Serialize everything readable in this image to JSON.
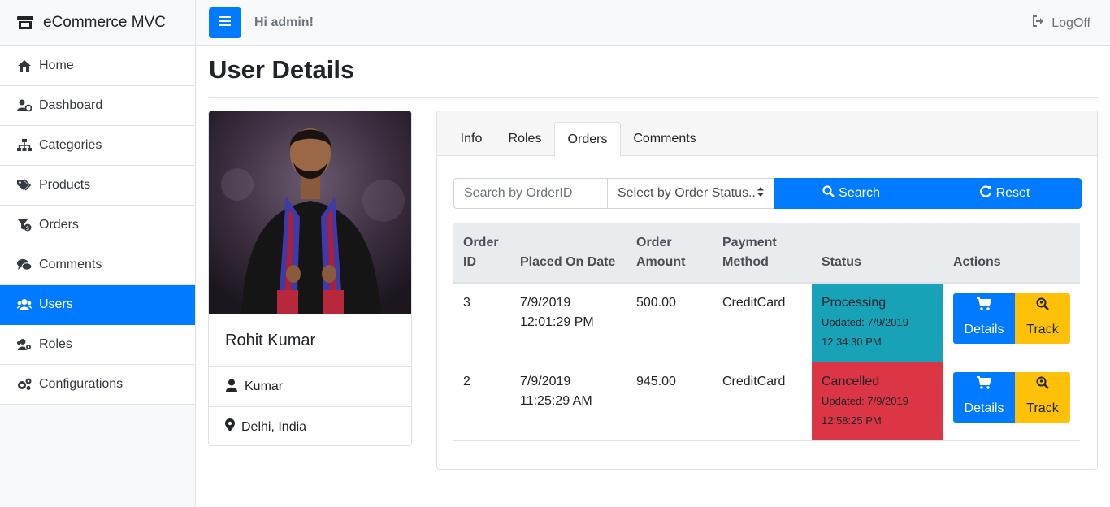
{
  "brand": {
    "title": "eCommerce MVC"
  },
  "sidebar": {
    "items": [
      {
        "label": "Home",
        "icon": "home-icon",
        "active": false
      },
      {
        "label": "Dashboard",
        "icon": "user-chart-icon",
        "active": false
      },
      {
        "label": "Categories",
        "icon": "sitemap-icon",
        "active": false
      },
      {
        "label": "Products",
        "icon": "tags-icon",
        "active": false
      },
      {
        "label": "Orders",
        "icon": "funnel-dollar-icon",
        "active": false
      },
      {
        "label": "Comments",
        "icon": "comments-icon",
        "active": false
      },
      {
        "label": "Users",
        "icon": "users-icon",
        "active": true
      },
      {
        "label": "Roles",
        "icon": "users-cog-icon",
        "active": false
      },
      {
        "label": "Configurations",
        "icon": "cogs-icon",
        "active": false
      }
    ]
  },
  "header": {
    "greeting": "Hi admin!",
    "logoff_label": "LogOff"
  },
  "page": {
    "title": "User Details"
  },
  "profile": {
    "name": "Rohit Kumar",
    "username": "Kumar",
    "location": "Delhi, India"
  },
  "tabs": [
    {
      "label": "Info",
      "active": false
    },
    {
      "label": "Roles",
      "active": false
    },
    {
      "label": "Orders",
      "active": true
    },
    {
      "label": "Comments",
      "active": false
    }
  ],
  "search": {
    "placeholder": "Search by OrderID",
    "status_select": "Select by Order Status..",
    "search_label": "Search",
    "reset_label": "Reset"
  },
  "orders_table": {
    "headers": {
      "order_id_1": "Order",
      "order_id_2": "ID",
      "placed_on": "Placed On Date",
      "amount_1": "Order",
      "amount_2": "Amount",
      "payment_1": "Payment",
      "payment_2": "Method",
      "status": "Status",
      "actions": "Actions"
    },
    "rows": [
      {
        "order_id": "3",
        "date": "7/9/2019",
        "time": "12:01:29 PM",
        "amount": "500.00",
        "payment": "CreditCard",
        "status": "Processing",
        "updated_date": "Updated: 7/9/2019",
        "updated_time": "12:34:30 PM",
        "details_label": "Details",
        "track_label": "Track"
      },
      {
        "order_id": "2",
        "date": "7/9/2019",
        "time": "11:25:29 AM",
        "amount": "945.00",
        "payment": "CreditCard",
        "status": "Cancelled",
        "updated_date": "Updated: 7/9/2019",
        "updated_time": "12:58:25 PM",
        "details_label": "Details",
        "track_label": "Track"
      }
    ]
  },
  "colors": {
    "primary": "#007bff",
    "info": "#17a2b8",
    "danger": "#dc3545",
    "warning": "#ffc107"
  }
}
